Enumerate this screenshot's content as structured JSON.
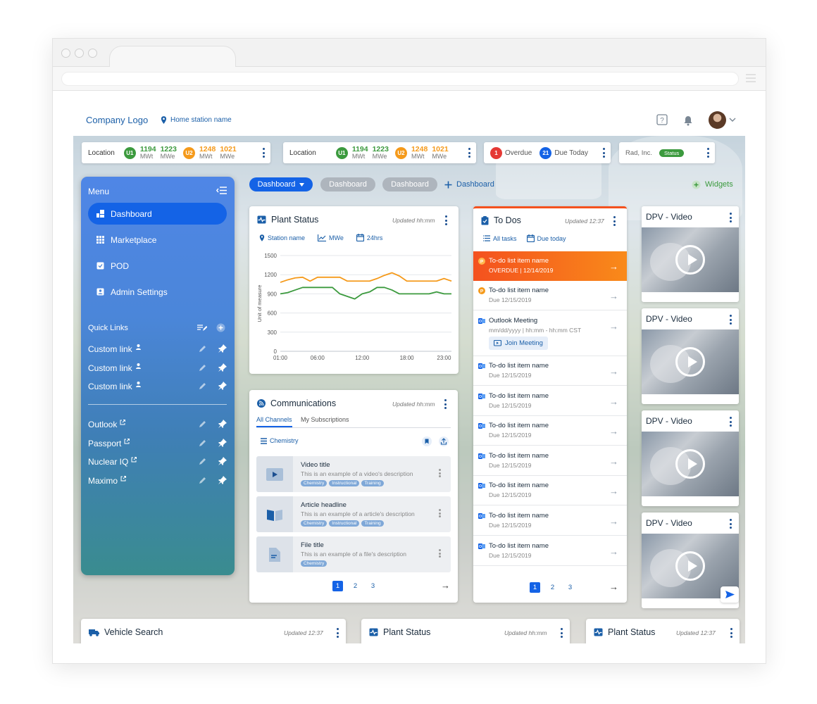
{
  "header": {
    "logo": "Company Logo",
    "station": "Home station name"
  },
  "status_bar": {
    "loc1": {
      "label": "Location",
      "u1": "U1",
      "u1_mwt": "1194",
      "u1_mwe": "1223",
      "u2": "U2",
      "u2_mwt": "1248",
      "u2_mwe": "1021",
      "mwt_unit": "MWt",
      "mwe_unit": "MWe"
    },
    "loc2": {
      "label": "Location",
      "u1": "U1",
      "u1_mwt": "1194",
      "u1_mwe": "1223",
      "u2": "U2",
      "u2_mwt": "1248",
      "u2_mwe": "1021",
      "mwt_unit": "MWt",
      "mwe_unit": "MWe"
    },
    "tasks": {
      "overdue_count": "1",
      "overdue_label": "Overdue",
      "due_count": "21",
      "due_label": "Due Today"
    },
    "company": {
      "name": "Rad, Inc.",
      "status": "Status"
    }
  },
  "menu": {
    "title": "Menu",
    "items": [
      {
        "label": "Dashboard"
      },
      {
        "label": "Marketplace"
      },
      {
        "label": "POD"
      },
      {
        "label": "Admin Settings"
      }
    ],
    "quick_links_title": "Quick Links",
    "custom_links": [
      {
        "label": "Custom link"
      },
      {
        "label": "Custom link"
      },
      {
        "label": "Custom link"
      }
    ],
    "external_links": [
      {
        "label": "Outlook"
      },
      {
        "label": "Passport"
      },
      {
        "label": "Nuclear IQ"
      },
      {
        "label": "Maximo"
      }
    ]
  },
  "tabs": {
    "active": "Dashboard",
    "tab2": "Dashboard",
    "tab3": "Dashboard",
    "add": "Dashboard",
    "widgets": "Widgets"
  },
  "plant_status": {
    "title": "Plant Status",
    "updated": "Updated hh:mm",
    "filter_station": "Station name",
    "filter_unit": "MWe",
    "filter_time": "24hrs",
    "ylabel": "Unit of measure"
  },
  "chart_data": {
    "type": "line",
    "x": [
      "01:00",
      "02:00",
      "03:00",
      "04:00",
      "05:00",
      "06:00",
      "07:00",
      "08:00",
      "09:00",
      "10:00",
      "11:00",
      "12:00",
      "13:00",
      "14:00",
      "15:00",
      "16:00",
      "17:00",
      "18:00",
      "19:00",
      "20:00",
      "21:00",
      "22:00",
      "23:00",
      "24:00"
    ],
    "xticks": [
      "01:00",
      "06:00",
      "12:00",
      "18:00",
      "23:00"
    ],
    "yticks": [
      "0",
      "300",
      "600",
      "900",
      "1200",
      "1500"
    ],
    "ylim": [
      0,
      1500
    ],
    "ylabel": "Unit of measure",
    "series": [
      {
        "color": "#f59a1b",
        "values": [
          1080,
          1120,
          1150,
          1160,
          1100,
          1160,
          1160,
          1160,
          1160,
          1100,
          1100,
          1100,
          1100,
          1140,
          1190,
          1230,
          1180,
          1100,
          1100,
          1100,
          1100,
          1100,
          1140,
          1100
        ]
      },
      {
        "color": "#3c9a3e",
        "values": [
          900,
          920,
          960,
          1000,
          1000,
          1000,
          1000,
          1000,
          900,
          860,
          820,
          900,
          930,
          1000,
          1000,
          960,
          900,
          900,
          900,
          900,
          900,
          930,
          900,
          900
        ]
      }
    ]
  },
  "communications": {
    "title": "Communications",
    "updated": "Updated hh:mm",
    "tab_all": "All Channels",
    "tab_subs": "My Subscriptions",
    "filter": "Chemistry",
    "items": [
      {
        "title": "Video title",
        "desc": "This is an example of a video's description",
        "tags": [
          "Chemistry",
          "Instructional",
          "Training"
        ]
      },
      {
        "title": "Article headline",
        "desc": "This is an example of a article's description",
        "tags": [
          "Chemistry",
          "Instructional",
          "Training"
        ]
      },
      {
        "title": "File title",
        "desc": "This is an example of a file's description",
        "tags": [
          "Chemistry"
        ]
      }
    ],
    "pages": [
      "1",
      "2",
      "3"
    ]
  },
  "todos": {
    "title": "To Dos",
    "updated": "Updated 12:37",
    "filter_all": "All tasks",
    "filter_due": "Due today",
    "overdue_item": {
      "name": "To-do list item name",
      "sub": "OVERDUE | 12/14/2019"
    },
    "item2": {
      "name": "To-do list item name",
      "sub": "Due 12/15/2019"
    },
    "meeting": {
      "name": "Outlook Meeting",
      "sub": "mm/dd/yyyy | hh:mm - hh:mm CST",
      "join": "Join Meeting"
    },
    "items": [
      {
        "name": "To-do list item name",
        "sub": "Due 12/15/2019"
      },
      {
        "name": "To-do list item name",
        "sub": "Due 12/15/2019"
      },
      {
        "name": "To-do list item name",
        "sub": "Due 12/15/2019"
      },
      {
        "name": "To-do list item name",
        "sub": "Due 12/15/2019"
      },
      {
        "name": "To-do list item name",
        "sub": "Due 12/15/2019"
      },
      {
        "name": "To-do list item name",
        "sub": "Due 12/15/2019"
      },
      {
        "name": "To-do list item name",
        "sub": "Due 12/15/2019"
      }
    ],
    "pages": [
      "1",
      "2",
      "3"
    ]
  },
  "videos": [
    {
      "title": "DPV - Video"
    },
    {
      "title": "DPV - Video"
    },
    {
      "title": "DPV - Video"
    },
    {
      "title": "DPV - Video"
    }
  ],
  "bottom": {
    "vehicle": {
      "title": "Vehicle Search",
      "updated": "Updated 12:37"
    },
    "plant1": {
      "title": "Plant Status",
      "updated": "Updated hh:mm"
    },
    "plant2": {
      "title": "Plant Status",
      "updated": "Updated 12:37"
    }
  },
  "colors": {
    "primary": "#1463e6",
    "green": "#3c9a3e",
    "orange": "#f59a1b",
    "red": "#e53935",
    "overdue": "#f4511e"
  }
}
